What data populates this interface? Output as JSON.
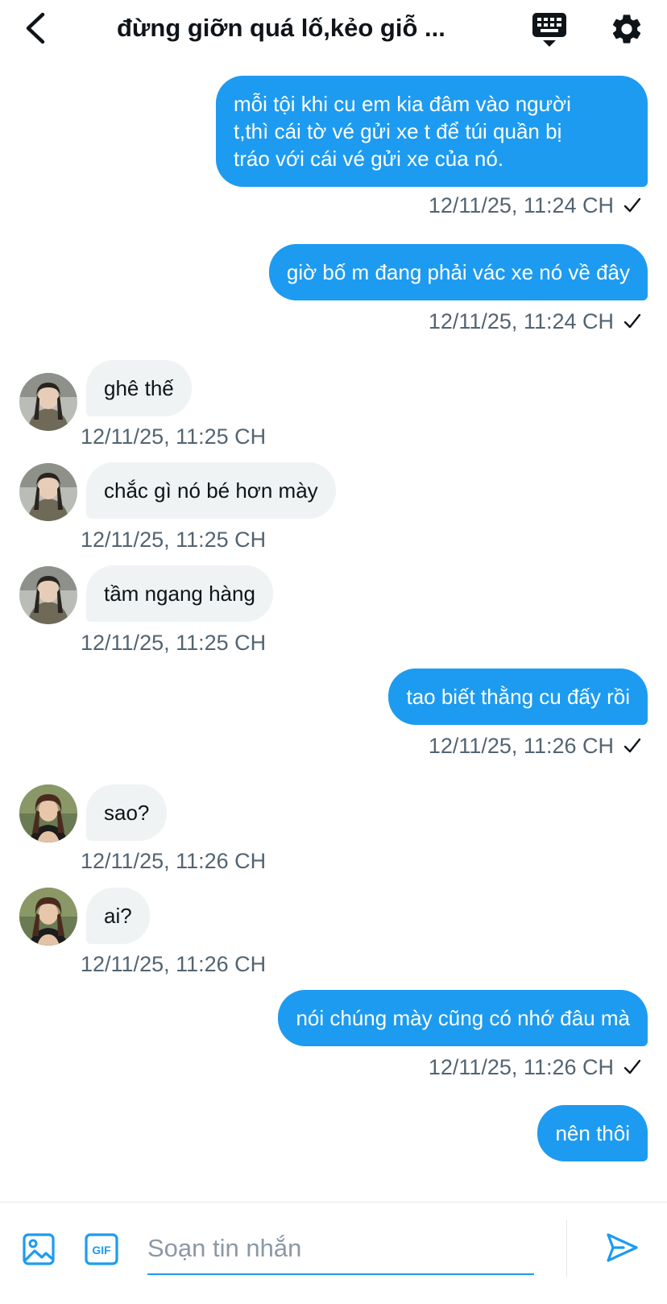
{
  "header": {
    "title": "đừng giỡn quá lố,kẻo giỗ ...",
    "back_icon": "chevron-left-icon",
    "keyboard_icon": "keyboard-icon",
    "settings_icon": "gear-icon"
  },
  "colors": {
    "accent": "#1d9bf0",
    "incoming_bubble": "#eff3f4",
    "timestamp": "#536471"
  },
  "messages": [
    {
      "direction": "out",
      "text": "mỗi tội khi cu em kia đâm vào người\nt,thì cái tờ vé gửi xe t để túi quần bị\ntráo với cái vé gửi xe của nó.",
      "time": "12/11/25, 11:24 CH",
      "seen": true
    },
    {
      "direction": "out",
      "text": "giờ bố m đang phải vác xe nó về đây",
      "time": "12/11/25, 11:24 CH",
      "seen": true
    },
    {
      "direction": "in",
      "text": "ghê thế",
      "time": "12/11/25, 11:25 CH",
      "avatar": "avatar-a"
    },
    {
      "direction": "in",
      "text": "chắc gì nó bé hơn mày",
      "time": "12/11/25, 11:25 CH",
      "avatar": "avatar-a"
    },
    {
      "direction": "in",
      "text": "tầm ngang hàng",
      "time": "12/11/25, 11:25 CH",
      "avatar": "avatar-a"
    },
    {
      "direction": "out",
      "text": "tao biết thằng cu đấy rồi",
      "time": "12/11/25, 11:26 CH",
      "seen": true
    },
    {
      "direction": "in",
      "text": "sao?",
      "time": "12/11/25, 11:26 CH",
      "avatar": "avatar-b"
    },
    {
      "direction": "in",
      "text": "ai?",
      "time": "12/11/25, 11:26 CH",
      "avatar": "avatar-b"
    },
    {
      "direction": "out",
      "text": "nói chúng mày cũng có nhớ đâu mà",
      "time": "12/11/25, 11:26 CH",
      "seen": true
    },
    {
      "direction": "out",
      "text": "nên thôi",
      "time": "",
      "seen": false
    }
  ],
  "composer": {
    "placeholder": "Soạn tin nhắn",
    "value": "",
    "image_icon": "image-icon",
    "gif_icon": "gif-icon",
    "gif_label": "GIF",
    "send_icon": "send-icon"
  }
}
